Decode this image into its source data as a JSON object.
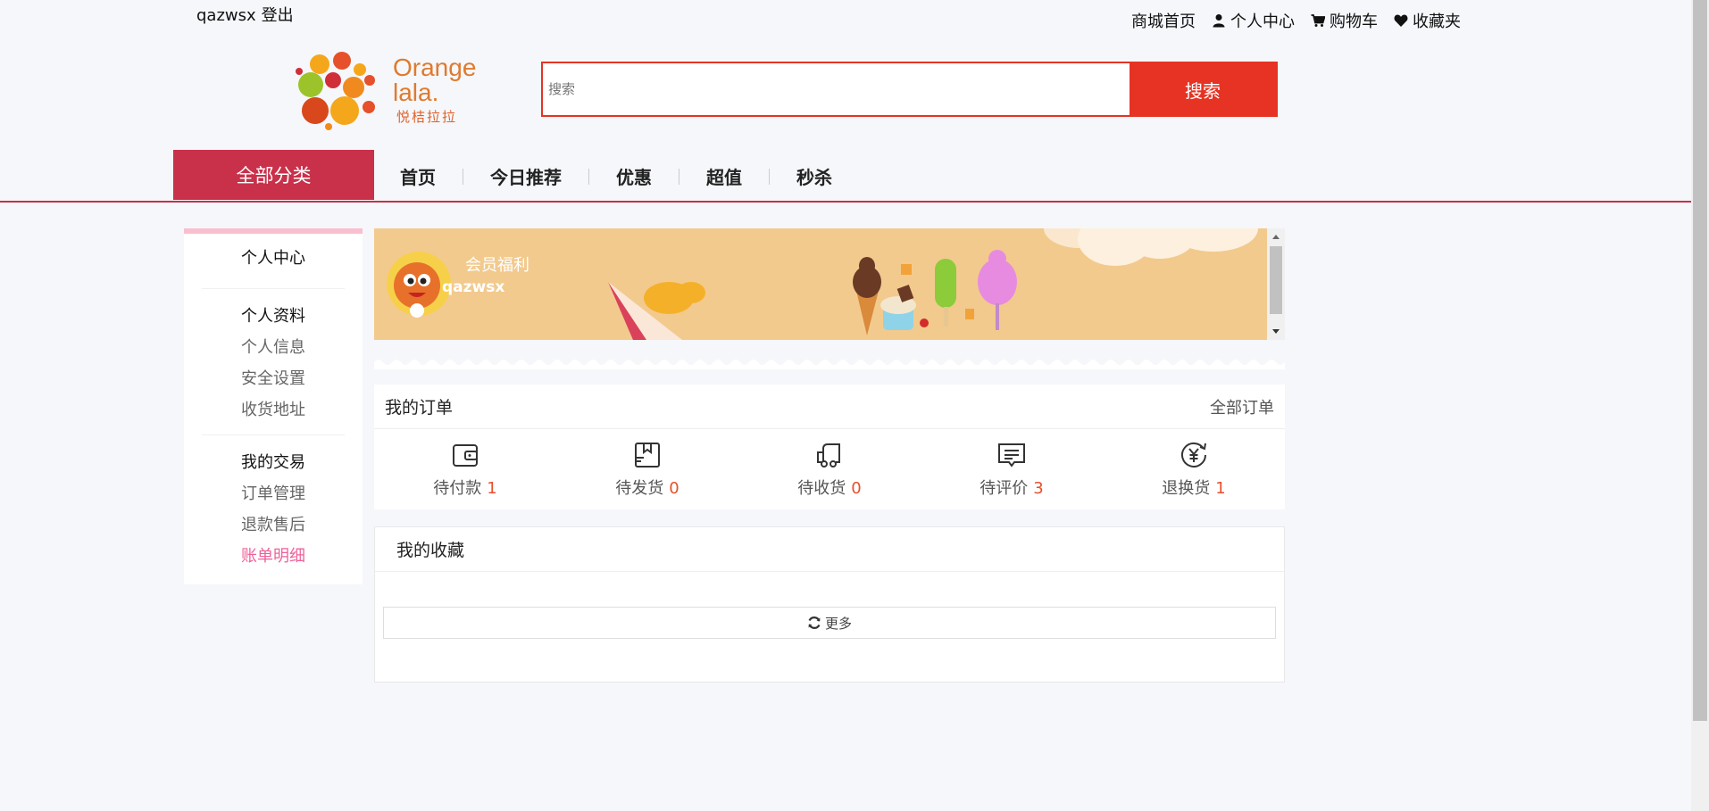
{
  "top": {
    "username": "qazwsx",
    "logout": "登出",
    "links": [
      {
        "label": "商城首页",
        "icon": ""
      },
      {
        "label": "个人中心",
        "icon": "user-icon"
      },
      {
        "label": "购物车",
        "icon": "cart-icon"
      },
      {
        "label": "收藏夹",
        "icon": "heart-icon"
      }
    ]
  },
  "logo": {
    "line1": "Orange",
    "line2": "lala.",
    "sub": "悦桔拉拉"
  },
  "search": {
    "placeholder": "搜索",
    "button": "搜索"
  },
  "nav": {
    "category": "全部分类",
    "items": [
      "首页",
      "今日推荐",
      "优惠",
      "超值",
      "秒杀"
    ]
  },
  "sidebar": {
    "title": "个人中心",
    "groups": [
      {
        "title": "个人资料",
        "items": [
          "个人信息",
          "安全设置",
          "收货地址"
        ]
      },
      {
        "title": "我的交易",
        "items": [
          "订单管理",
          "退款售后",
          "账单明细"
        ]
      }
    ],
    "active_item": "账单明细"
  },
  "banner": {
    "title": "会员福利",
    "username": "qazwsx"
  },
  "orders": {
    "title": "我的订单",
    "all": "全部订单",
    "statuses": [
      {
        "label": "待付款",
        "count": "1",
        "icon": "wallet-icon"
      },
      {
        "label": "待发货",
        "count": "0",
        "icon": "package-icon"
      },
      {
        "label": "待收货",
        "count": "0",
        "icon": "truck-icon"
      },
      {
        "label": "待评价",
        "count": "3",
        "icon": "comment-icon"
      },
      {
        "label": "退换货",
        "count": "1",
        "icon": "refund-icon"
      }
    ]
  },
  "favorites": {
    "title": "我的收藏",
    "more": "更多"
  },
  "colors": {
    "accent_red": "#e63323",
    "nav_red": "#c9304a",
    "active_pink": "#f0609a",
    "count_orange": "#e6502a",
    "banner_bg": "#f2ca8e"
  }
}
